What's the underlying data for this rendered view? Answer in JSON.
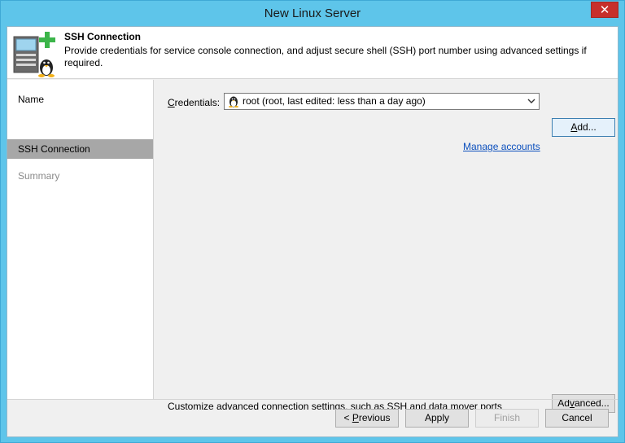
{
  "window": {
    "title": "New Linux Server",
    "close_glyph": "✕"
  },
  "header": {
    "icon": "linux-server-add-icon",
    "title": "SSH Connection",
    "description": "Provide credentials for service console connection, and adjust secure shell (SSH) port number using advanced settings if required."
  },
  "sidebar": {
    "items": [
      {
        "label": "Name",
        "state": "normal"
      },
      {
        "label": "SSH Connection",
        "state": "active"
      },
      {
        "label": "Summary",
        "state": "disabled"
      }
    ]
  },
  "main": {
    "credentials_label_key": "C",
    "credentials_label_rest": "redentials:",
    "credentials_value": "root (root, last edited: less than a day ago)",
    "add_button_key": "A",
    "add_button_rest": "dd...",
    "manage_accounts_link": "Manage accounts",
    "advanced_text": "Customize advanced connection settings, such as SSH and data mover ports",
    "advanced_button_key": "v",
    "advanced_button_pre": "Ad",
    "advanced_button_post": "anced..."
  },
  "footer": {
    "previous_pre": "< ",
    "previous_key": "P",
    "previous_rest": "revious",
    "apply_label": "Apply",
    "finish_label": "Finish",
    "cancel_label": "Cancel"
  },
  "colors": {
    "title_bar": "#5ec5ea",
    "close_button": "#c7302b",
    "active_nav": "#a7a7a7",
    "link": "#0b4fbd"
  }
}
